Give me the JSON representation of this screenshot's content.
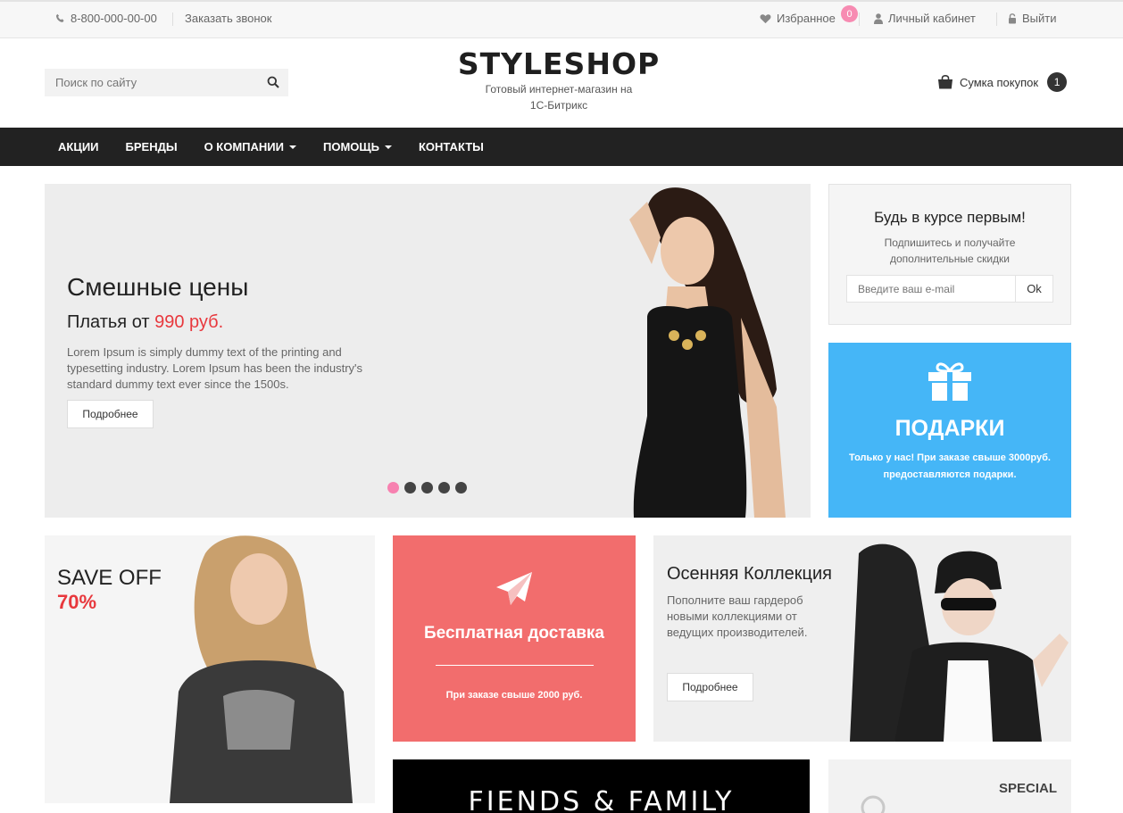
{
  "topbar": {
    "phone": "8-800-000-00-00",
    "callback": "Заказать звонок",
    "favorites": "Избранное",
    "favorites_count": "0",
    "account": "Личный кабинет",
    "logout": "Выйти"
  },
  "header": {
    "search_placeholder": "Поиск по сайту",
    "logo": "STYLESHOP",
    "tagline": "Готовый интернет-магазин на 1С-Битрикс",
    "bag_label": "Сумка покупок",
    "bag_count": "1"
  },
  "nav": {
    "items": [
      {
        "label": "АКЦИИ"
      },
      {
        "label": "БРЕНДЫ"
      },
      {
        "label": "О КОМПАНИИ"
      },
      {
        "label": "ПОМОЩЬ"
      },
      {
        "label": "КОНТАКТЫ"
      }
    ]
  },
  "slider": {
    "title": "Смешные цены",
    "subtitle_prefix": "Платья от ",
    "price": "990 руб.",
    "text": "Lorem Ipsum is simply dummy text of the printing and typesetting industry. Lorem Ipsum has been the industry's standard dummy text ever since the 1500s.",
    "button": "Подробнее",
    "active_dot": 1,
    "dots_total": 5
  },
  "subscribe": {
    "title": "Будь в курсе первым!",
    "text": "Подпишитесь и получайте дополнительные скидки",
    "placeholder": "Введите ваш e-mail",
    "button": "Ok"
  },
  "gifts": {
    "title": "ПОДАРКИ",
    "text": "Только у нас! При заказе свыше 3000руб. предоставляются подарки.",
    "color": "#45b6f7"
  },
  "saveoff": {
    "line1": "SAVE OFF",
    "line2": "70%"
  },
  "delivery": {
    "title": "Бесплатная доставка",
    "text": "При заказе свыше 2000 руб.",
    "color": "#f26d6d"
  },
  "autumn": {
    "title": "Осенняя Коллекция",
    "text": "Пополните ваш гардероб новыми коллекциями от ведущих производителей.",
    "button": "Подробнее"
  },
  "promo": {
    "fiends": "FIENDS & FAMILY",
    "special": "SPECIAL"
  },
  "colors": {
    "accent_pink": "#f781b0",
    "price_red": "#e8383d",
    "nav_bg": "#222222"
  }
}
